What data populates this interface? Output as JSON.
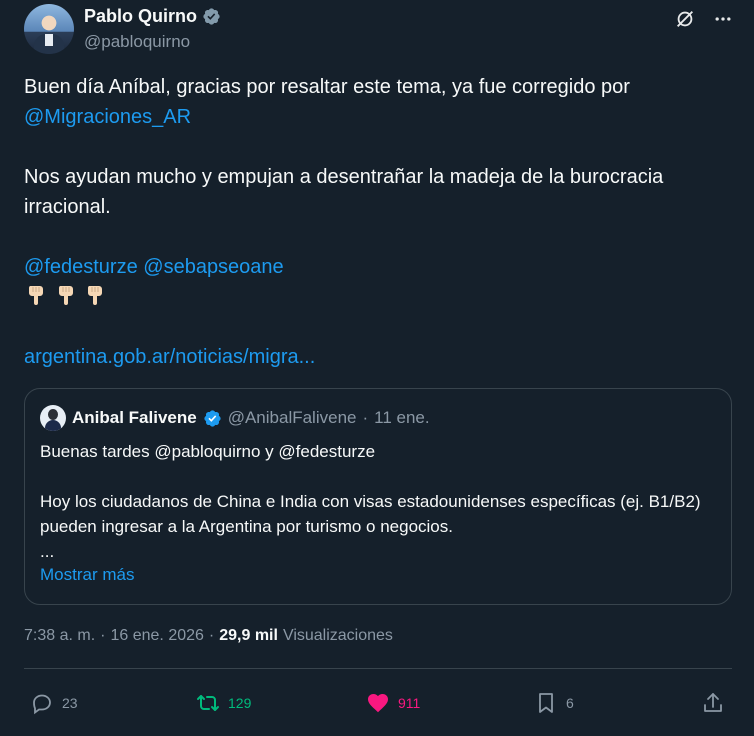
{
  "author": {
    "display_name": "Pablo Quirno",
    "handle": "@pabloquirno"
  },
  "tweet": {
    "line1": "Buen día Aníbal, gracias por resaltar este tema, ya fue corregido por",
    "mention_migraciones": "@Migraciones_AR",
    "line2": "Nos ayudan mucho y empujan a desentrañar la madeja de la burocracia irracional.",
    "mention_fede": "@fedesturze",
    "mention_seba": "@sebapseoane",
    "link": "argentina.gob.ar/noticias/migra..."
  },
  "quoted": {
    "display_name": "Anibal Falivene",
    "handle": "@AnibalFalivene",
    "separator": "·",
    "date": "11 ene.",
    "line1": "Buenas tardes @pabloquirno y @fedesturze",
    "line2": "Hoy los ciudadanos de China e India con visas estadounidenses específicas (ej. B1/B2) pueden ingresar a la Argentina por turismo o negocios.",
    "ellipsis": "...",
    "show_more": "Mostrar más"
  },
  "meta": {
    "time": "7:38 a. m.",
    "sep1": "·",
    "date": "16 ene. 2026",
    "sep2": "·",
    "views_count": "29,9 mil",
    "views_label": "Visualizaciones"
  },
  "actions": {
    "replies": "23",
    "reposts": "129",
    "likes": "911",
    "bookmarks": "6"
  },
  "colors": {
    "background": "#15202b",
    "accent": "#1d9bf0",
    "repost": "#00ba7c",
    "like": "#f91880",
    "muted": "#8b98a5"
  }
}
